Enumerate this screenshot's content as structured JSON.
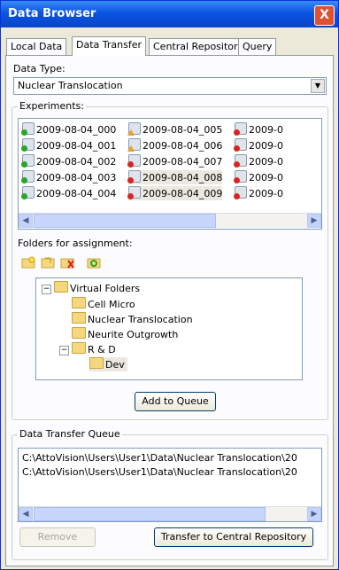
{
  "window": {
    "title": "Data Browser",
    "close_glyph": "X"
  },
  "tabs": [
    {
      "label": "Local Data"
    },
    {
      "label": "Data Transfer"
    },
    {
      "label": "Central Repository"
    },
    {
      "label": "Query"
    }
  ],
  "data_type": {
    "label": "Data Type:",
    "value": "Nuclear Translocation"
  },
  "experiments": {
    "label": "Experiments:",
    "col1": [
      "2009-08-04_000",
      "2009-08-04_001",
      "2009-08-04_002",
      "2009-08-04_003",
      "2009-08-04_004"
    ],
    "col2": [
      "2009-08-04_005",
      "2009-08-04_006",
      "2009-08-04_007",
      "2009-08-04_008",
      "2009-08-04_009"
    ],
    "col3": [
      "2009-0",
      "2009-0",
      "2009-0",
      "2009-0",
      "2009-0"
    ]
  },
  "folders": {
    "label": "Folders for assignment:",
    "tree": {
      "root": "Virtual Folders",
      "children": [
        "Cell Micro",
        "Nuclear Translocation",
        "Neurite Outgrowth",
        "R & D"
      ],
      "grandchild": "Dev"
    },
    "add_button": "Add to Queue"
  },
  "queue": {
    "label": "Data Transfer Queue",
    "paths": [
      "C:\\AttoVision\\Users\\User1\\Data\\Nuclear Translocation\\20",
      "C:\\AttoVision\\Users\\User1\\Data\\Nuclear Translocation\\20"
    ],
    "remove_button": "Remove",
    "transfer_button": "Transfer to Central Repository"
  }
}
